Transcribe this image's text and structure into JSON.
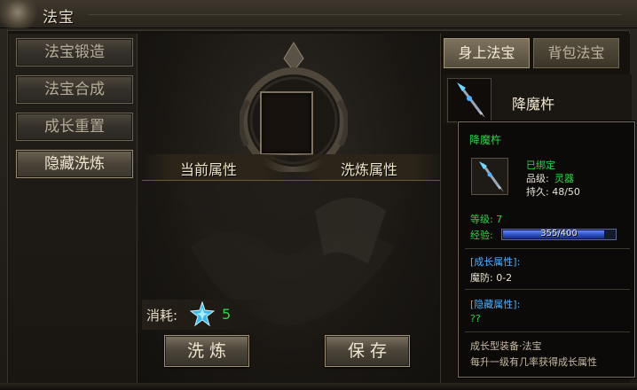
{
  "window": {
    "title": "法宝"
  },
  "sidebar": {
    "items": [
      {
        "label": "法宝锻造"
      },
      {
        "label": "法宝合成"
      },
      {
        "label": "成长重置"
      },
      {
        "label": "隐藏洗炼"
      }
    ],
    "active_index": 3
  },
  "center": {
    "current_attr_label": "当前属性",
    "refine_attr_label": "洗炼属性",
    "cost_label": "消耗:",
    "cost_value": "5",
    "cost_icon": "crystal-gem-icon",
    "refine_button": "洗炼",
    "save_button": "保存"
  },
  "right": {
    "tabs": [
      {
        "label": "身上法宝"
      },
      {
        "label": "背包法宝"
      }
    ],
    "active_tab": 0,
    "item": {
      "name": "降魔杵",
      "icon": "pestle-staff-icon"
    }
  },
  "tooltip": {
    "name": "降魔杵",
    "bound": "已绑定",
    "quality_label": "品级:",
    "quality_value": "灵器",
    "durability": "持久: 48/50",
    "level": "等级: 7",
    "exp_label": "经验:",
    "exp_text": "355/400",
    "exp_fraction": 0.8875,
    "growth_header": "[成长属性]:",
    "growth_line": "魔防: 0-2",
    "hidden_header": "[隐藏属性]:",
    "hidden_line": "??",
    "desc_1": "成长型装备·法宝",
    "desc_2": "每升一级有几率获得成长属性"
  },
  "colors": {
    "green": "#31d04a",
    "blue": "#4fb1ff",
    "gold_text": "#f0e6c8"
  }
}
